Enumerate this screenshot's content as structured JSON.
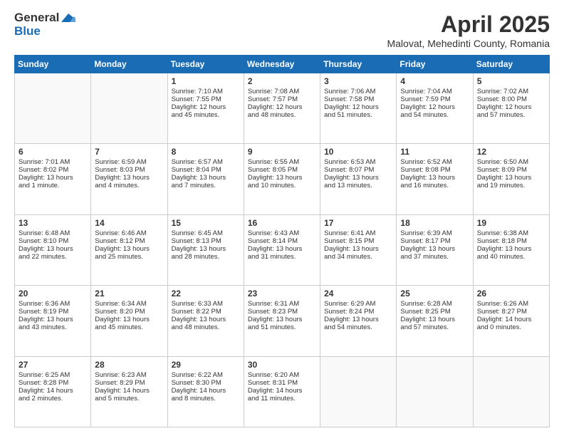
{
  "logo": {
    "general": "General",
    "blue": "Blue"
  },
  "title": "April 2025",
  "location": "Malovat, Mehedinti County, Romania",
  "days_of_week": [
    "Sunday",
    "Monday",
    "Tuesday",
    "Wednesday",
    "Thursday",
    "Friday",
    "Saturday"
  ],
  "weeks": [
    [
      {
        "day": null,
        "info": null
      },
      {
        "day": null,
        "info": null
      },
      {
        "day": "1",
        "info": "Sunrise: 7:10 AM\nSunset: 7:55 PM\nDaylight: 12 hours\nand 45 minutes."
      },
      {
        "day": "2",
        "info": "Sunrise: 7:08 AM\nSunset: 7:57 PM\nDaylight: 12 hours\nand 48 minutes."
      },
      {
        "day": "3",
        "info": "Sunrise: 7:06 AM\nSunset: 7:58 PM\nDaylight: 12 hours\nand 51 minutes."
      },
      {
        "day": "4",
        "info": "Sunrise: 7:04 AM\nSunset: 7:59 PM\nDaylight: 12 hours\nand 54 minutes."
      },
      {
        "day": "5",
        "info": "Sunrise: 7:02 AM\nSunset: 8:00 PM\nDaylight: 12 hours\nand 57 minutes."
      }
    ],
    [
      {
        "day": "6",
        "info": "Sunrise: 7:01 AM\nSunset: 8:02 PM\nDaylight: 13 hours\nand 1 minute."
      },
      {
        "day": "7",
        "info": "Sunrise: 6:59 AM\nSunset: 8:03 PM\nDaylight: 13 hours\nand 4 minutes."
      },
      {
        "day": "8",
        "info": "Sunrise: 6:57 AM\nSunset: 8:04 PM\nDaylight: 13 hours\nand 7 minutes."
      },
      {
        "day": "9",
        "info": "Sunrise: 6:55 AM\nSunset: 8:05 PM\nDaylight: 13 hours\nand 10 minutes."
      },
      {
        "day": "10",
        "info": "Sunrise: 6:53 AM\nSunset: 8:07 PM\nDaylight: 13 hours\nand 13 minutes."
      },
      {
        "day": "11",
        "info": "Sunrise: 6:52 AM\nSunset: 8:08 PM\nDaylight: 13 hours\nand 16 minutes."
      },
      {
        "day": "12",
        "info": "Sunrise: 6:50 AM\nSunset: 8:09 PM\nDaylight: 13 hours\nand 19 minutes."
      }
    ],
    [
      {
        "day": "13",
        "info": "Sunrise: 6:48 AM\nSunset: 8:10 PM\nDaylight: 13 hours\nand 22 minutes."
      },
      {
        "day": "14",
        "info": "Sunrise: 6:46 AM\nSunset: 8:12 PM\nDaylight: 13 hours\nand 25 minutes."
      },
      {
        "day": "15",
        "info": "Sunrise: 6:45 AM\nSunset: 8:13 PM\nDaylight: 13 hours\nand 28 minutes."
      },
      {
        "day": "16",
        "info": "Sunrise: 6:43 AM\nSunset: 8:14 PM\nDaylight: 13 hours\nand 31 minutes."
      },
      {
        "day": "17",
        "info": "Sunrise: 6:41 AM\nSunset: 8:15 PM\nDaylight: 13 hours\nand 34 minutes."
      },
      {
        "day": "18",
        "info": "Sunrise: 6:39 AM\nSunset: 8:17 PM\nDaylight: 13 hours\nand 37 minutes."
      },
      {
        "day": "19",
        "info": "Sunrise: 6:38 AM\nSunset: 8:18 PM\nDaylight: 13 hours\nand 40 minutes."
      }
    ],
    [
      {
        "day": "20",
        "info": "Sunrise: 6:36 AM\nSunset: 8:19 PM\nDaylight: 13 hours\nand 43 minutes."
      },
      {
        "day": "21",
        "info": "Sunrise: 6:34 AM\nSunset: 8:20 PM\nDaylight: 13 hours\nand 45 minutes."
      },
      {
        "day": "22",
        "info": "Sunrise: 6:33 AM\nSunset: 8:22 PM\nDaylight: 13 hours\nand 48 minutes."
      },
      {
        "day": "23",
        "info": "Sunrise: 6:31 AM\nSunset: 8:23 PM\nDaylight: 13 hours\nand 51 minutes."
      },
      {
        "day": "24",
        "info": "Sunrise: 6:29 AM\nSunset: 8:24 PM\nDaylight: 13 hours\nand 54 minutes."
      },
      {
        "day": "25",
        "info": "Sunrise: 6:28 AM\nSunset: 8:25 PM\nDaylight: 13 hours\nand 57 minutes."
      },
      {
        "day": "26",
        "info": "Sunrise: 6:26 AM\nSunset: 8:27 PM\nDaylight: 14 hours\nand 0 minutes."
      }
    ],
    [
      {
        "day": "27",
        "info": "Sunrise: 6:25 AM\nSunset: 8:28 PM\nDaylight: 14 hours\nand 2 minutes."
      },
      {
        "day": "28",
        "info": "Sunrise: 6:23 AM\nSunset: 8:29 PM\nDaylight: 14 hours\nand 5 minutes."
      },
      {
        "day": "29",
        "info": "Sunrise: 6:22 AM\nSunset: 8:30 PM\nDaylight: 14 hours\nand 8 minutes."
      },
      {
        "day": "30",
        "info": "Sunrise: 6:20 AM\nSunset: 8:31 PM\nDaylight: 14 hours\nand 11 minutes."
      },
      {
        "day": null,
        "info": null
      },
      {
        "day": null,
        "info": null
      },
      {
        "day": null,
        "info": null
      }
    ]
  ]
}
